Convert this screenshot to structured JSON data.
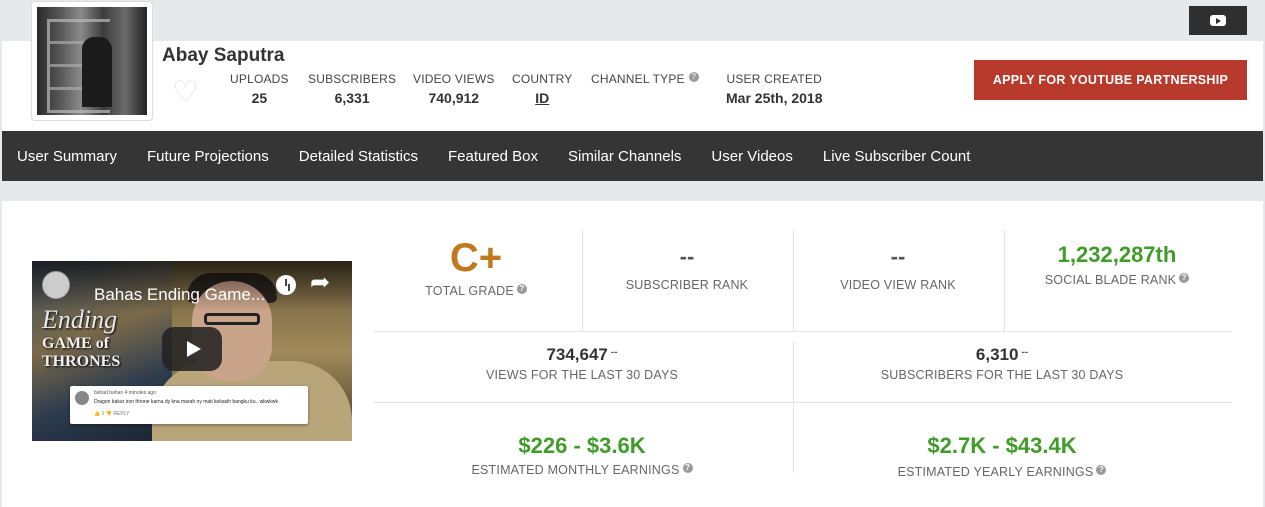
{
  "header": {
    "username": "Abay Saputra",
    "stats": [
      {
        "label": "UPLOADS",
        "value": "25"
      },
      {
        "label": "SUBSCRIBERS",
        "value": "6,331"
      },
      {
        "label": "VIDEO VIEWS",
        "value": "740,912"
      },
      {
        "label": "COUNTRY",
        "value": "ID"
      },
      {
        "label": "CHANNEL TYPE",
        "value": ""
      },
      {
        "label": "USER CREATED",
        "value": "Mar 25th, 2018"
      }
    ],
    "apply_label": "APPLY FOR YOUTUBE PARTNERSHIP",
    "help_glyph": "?"
  },
  "nav": {
    "items": [
      "User Summary",
      "Future Projections",
      "Detailed Statistics",
      "Featured Box",
      "Similar Channels",
      "User Videos",
      "Live Subscriber Count"
    ]
  },
  "video": {
    "title": "Bahas Ending Game...",
    "overlay_line1": "Ending",
    "overlay_line2": "GAME of",
    "overlay_line3": "THRONES",
    "comment_author": "bahad bahan 4 minutes ago",
    "comment_text": "Dragon bakar iron throne karna dy kna marah ny mati kekasih bangku itu.. wkwkwk",
    "comment_actions": "👍 1   👎   REPLY"
  },
  "summary": {
    "grade": {
      "value": "C+",
      "label": "TOTAL GRADE"
    },
    "subscriber_rank": {
      "value": "--",
      "label": "SUBSCRIBER RANK"
    },
    "video_view_rank": {
      "value": "--",
      "label": "VIDEO VIEW RANK"
    },
    "social_blade_rank": {
      "value": "1,232,287th",
      "label": "SOCIAL BLADE RANK"
    },
    "views_30": {
      "value": "734,647",
      "sup": "--",
      "label": "VIEWS FOR THE LAST 30 DAYS"
    },
    "subs_30": {
      "value": "6,310",
      "sup": "--",
      "label": "SUBSCRIBERS FOR THE LAST 30 DAYS"
    },
    "monthly": {
      "value": "$226 - $3.6K",
      "label": "ESTIMATED MONTHLY EARNINGS"
    },
    "yearly": {
      "value": "$2.7K - $43.4K",
      "label": "ESTIMATED YEARLY EARNINGS"
    }
  },
  "colors": {
    "accent_red": "#b73a2d",
    "grade_orange": "#c07a1e",
    "money_green": "#3f9c28",
    "nav_bg": "#353535"
  },
  "icons": [
    "youtube-icon",
    "heart-icon",
    "help-icon",
    "play-icon",
    "clock-icon",
    "share-icon"
  ]
}
